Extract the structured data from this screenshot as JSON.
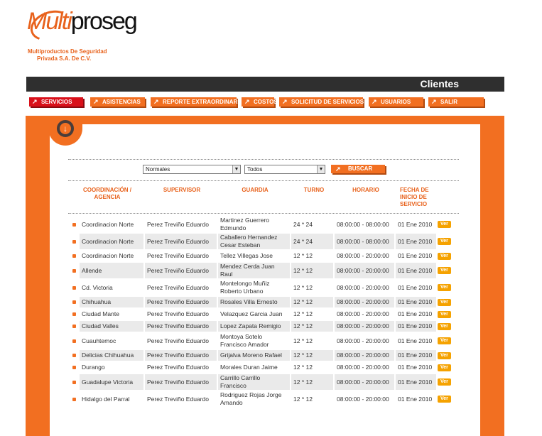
{
  "logo": {
    "multi": "Multi",
    "proseg": "proseg",
    "sub1": "Multiproductos De Seguridad",
    "sub2": "Privada S.A. De C.V."
  },
  "header": {
    "title": "Clientes"
  },
  "nav": [
    {
      "label": "SERVICIOS",
      "active": true
    },
    {
      "label": "ASISTENCIAS"
    },
    {
      "label": "REPORTE EXTRAORDINARIO"
    },
    {
      "label": "COSTOS"
    },
    {
      "label": "SOLICITUD DE SERVICIOS"
    },
    {
      "label": "USUARIOS"
    },
    {
      "label": "SALIR"
    }
  ],
  "filters": {
    "tipo_value": "Normales",
    "estado_value": "Todos",
    "buscar_label": "BUSCAR"
  },
  "columns": {
    "coordinacion": "COORDINACIÓN / AGENCIA",
    "supervisor": "SUPERVISOR",
    "guardia": "GUARDIA",
    "turno": "TURNO",
    "horario": "HORARIO",
    "fecha": "FECHA DE INICIO DE SERVICIO"
  },
  "ver_label": "Ver",
  "rows": [
    {
      "coord": "Coordinacion Norte",
      "supervisor": "Perez Treviño Eduardo",
      "guardia": "Martinez Guerrero Edmundo",
      "turno": "24 * 24",
      "horario": "08:00:00 - 08:00:00",
      "fecha": "01 Ene 2010"
    },
    {
      "coord": "Coordinacion Norte",
      "supervisor": "Perez Treviño Eduardo",
      "guardia": "Caballero Hernandez Cesar Esteban",
      "turno": "24 * 24",
      "horario": "08:00:00 - 08:00:00",
      "fecha": "01 Ene 2010"
    },
    {
      "coord": "Coordinacion Norte",
      "supervisor": "Perez Treviño Eduardo",
      "guardia": "Tellez Villegas Jose",
      "turno": "12 * 12",
      "horario": "08:00:00 - 20:00:00",
      "fecha": "01 Ene 2010"
    },
    {
      "coord": "Allende",
      "supervisor": "Perez Treviño Eduardo",
      "guardia": "Mendez Cerda Juan Raul",
      "turno": "12 * 12",
      "horario": "08:00:00 - 20:00:00",
      "fecha": "01 Ene 2010"
    },
    {
      "coord": "Cd. Victoria",
      "supervisor": "Perez Treviño Eduardo",
      "guardia": "Montelongo Muñiz Roberto Urbano",
      "turno": "12 * 12",
      "horario": "08:00:00 - 20:00:00",
      "fecha": "01 Ene 2010"
    },
    {
      "coord": "Chihuahua",
      "supervisor": "Perez Treviño Eduardo",
      "guardia": "Rosales Villa Ernesto",
      "turno": "12 * 12",
      "horario": "08:00:00 - 20:00:00",
      "fecha": "01 Ene 2010"
    },
    {
      "coord": "Ciudad Mante",
      "supervisor": "Perez Treviño Eduardo",
      "guardia": "Velazquez Garcia Juan",
      "turno": "12 * 12",
      "horario": "08:00:00 - 20:00:00",
      "fecha": "01 Ene 2010"
    },
    {
      "coord": "Ciudad Valles",
      "supervisor": "Perez Treviño Eduardo",
      "guardia": "Lopez Zapata Remigio",
      "turno": "12 * 12",
      "horario": "08:00:00 - 20:00:00",
      "fecha": "01 Ene 2010"
    },
    {
      "coord": "Cuauhtemoc",
      "supervisor": "Perez Treviño Eduardo",
      "guardia": "Montoya Sotelo Francisco Amador",
      "turno": "12 * 12",
      "horario": "08:00:00 - 20:00:00",
      "fecha": "01 Ene 2010"
    },
    {
      "coord": "Delicias Chihuahua",
      "supervisor": "Perez Treviño Eduardo",
      "guardia": "Grijalva Moreno Rafael",
      "turno": "12 * 12",
      "horario": "08:00:00 - 20:00:00",
      "fecha": "01 Ene 2010"
    },
    {
      "coord": "Durango",
      "supervisor": "Perez Treviño Eduardo",
      "guardia": "Morales Duran Jaime",
      "turno": "12 * 12",
      "horario": "08:00:00 - 20:00:00",
      "fecha": "01 Ene 2010"
    },
    {
      "coord": "Guadalupe Victoria",
      "supervisor": "Perez Treviño Eduardo",
      "guardia": "Carrillo Carrillo Francisco",
      "turno": "12 * 12",
      "horario": "08:00:00 - 20:00:00",
      "fecha": "01 Ene 2010"
    },
    {
      "coord": "Hidalgo del Parral",
      "supervisor": "Perez Treviño Eduardo",
      "guardia": "Rodriguez Rojas Jorge Amando",
      "turno": "12 * 12",
      "horario": "08:00:00 - 20:00:00",
      "fecha": "01 Ene 2010"
    }
  ]
}
